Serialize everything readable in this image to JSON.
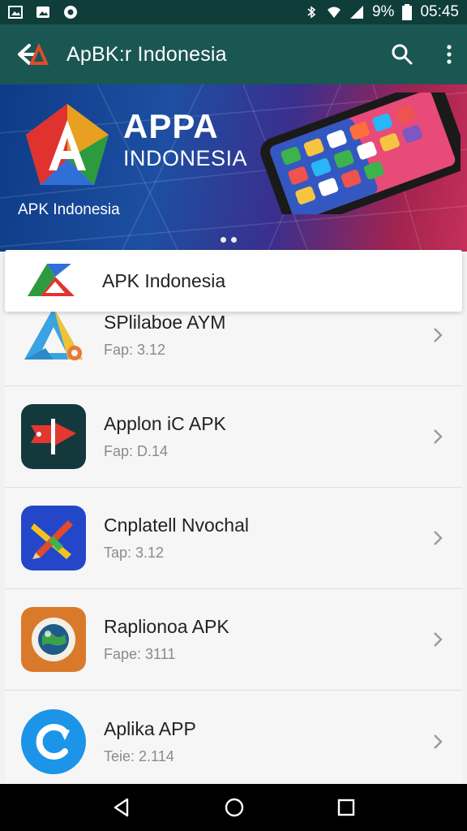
{
  "status_bar": {
    "battery": "9%",
    "time": "05:45",
    "icons": [
      "image-icon",
      "gallery-icon",
      "record-icon",
      "bluetooth-icon",
      "wifi-icon",
      "signal-icon",
      "battery-icon"
    ]
  },
  "app_bar": {
    "title": "ApBK:r Indonesia",
    "icons": [
      "back-logo-icon",
      "search-icon",
      "more-vert-icon"
    ]
  },
  "banner": {
    "title": "APPA",
    "subtitle": "INDONESIA",
    "caption": "APK Indonesia",
    "page_dots": 2
  },
  "header_card": {
    "title": "APK Indonesia"
  },
  "apps": [
    {
      "title": "SPlilaboe AYM",
      "subtitle": "Fap: 3.12",
      "icon": "triangle-a-icon"
    },
    {
      "title": "Applon iC APK",
      "subtitle": "Fap: D.14",
      "icon": "red-flag-icon"
    },
    {
      "title": "Cnplatell Nvochal",
      "subtitle": "Tap: 3.12",
      "icon": "pencil-ruler-icon"
    },
    {
      "title": "Raplionoa APK",
      "subtitle": "Fape: 3111",
      "icon": "globe-lens-icon"
    },
    {
      "title": "Aplika APP",
      "subtitle": "Teie: 2.114",
      "icon": "refresh-c-icon"
    }
  ],
  "colors": {
    "status_bar": "#0e3d3a",
    "app_bar": "#1b5752",
    "nav_bar": "#000000"
  }
}
